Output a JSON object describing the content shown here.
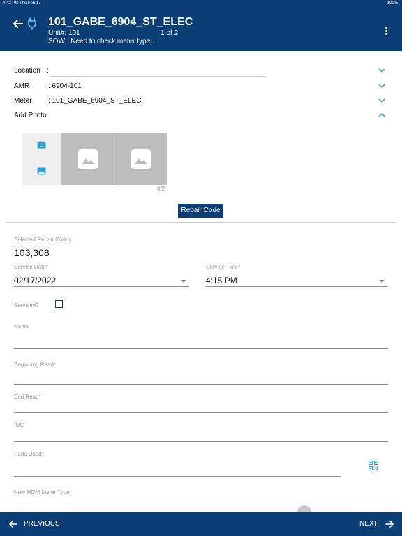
{
  "statusbar": {
    "time": "4:42 PM  Thu Feb 17",
    "battery": "100%"
  },
  "header": {
    "title": "101_GABE_6904_ST_ELEC",
    "unit": "Unit#: 101",
    "page": "1 of 2",
    "sow": "SOW : Need to check meter type..."
  },
  "details": {
    "location_label": "Location",
    "location_sep": ":",
    "location_value": "",
    "amr_label": "AMR",
    "amr_value": ": 6904-101",
    "meter_label": "Meter",
    "meter_value": ": 101_GABE_6904_ST_ELEC",
    "add_photo_label": "Add Photo",
    "photo_count": "0/2"
  },
  "repair_button_label": "Repair Code",
  "form": {
    "selected_codes_label": "Selected Repair Codes",
    "selected_codes_value": "103,308",
    "service_date_label": "Service Date*",
    "service_date_value": "02/17/2022",
    "service_time_label": "Service Time*",
    "service_time_value": "4:15 PM",
    "serviced_label": "Serviced?",
    "serviced_checked": false,
    "notes_label": "Notes",
    "beginning_read_label": "Beginning Read*",
    "end_read_label": "End Read*",
    "imc_label": "IMC",
    "parts_used_label": "Parts Used*",
    "new_meter_type_label": "New MDM Meter Type*"
  },
  "footer": {
    "previous_label": "PREVIOUS",
    "next_label": "NEXT"
  },
  "colors": {
    "primary": "#0b3e74",
    "accent": "#2a9fd6",
    "placeholder_gray": "#bdbdbd"
  },
  "icons": [
    "back-arrow-icon",
    "plug-icon",
    "more-vert-icon",
    "chevron-down-icon",
    "chevron-up-icon",
    "camera-icon",
    "gallery-icon",
    "image-placeholder-icon",
    "qr-code-icon",
    "arrow-left-icon",
    "arrow-right-icon"
  ]
}
